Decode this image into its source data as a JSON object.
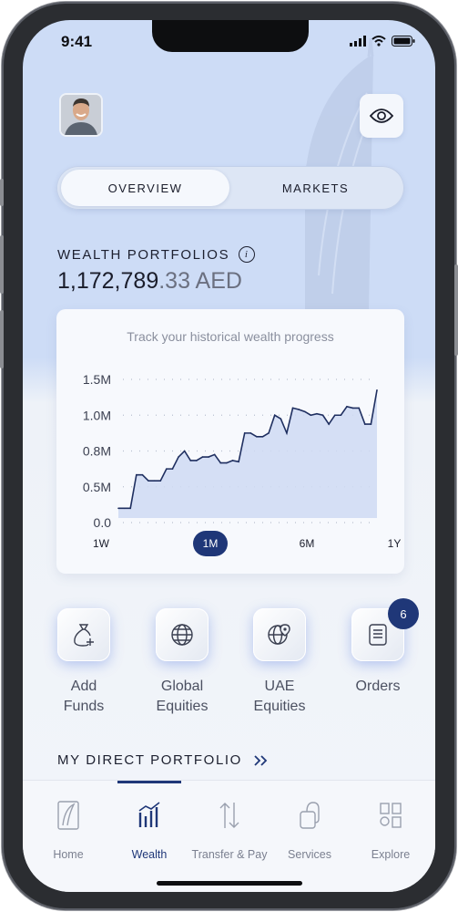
{
  "status_bar": {
    "time": "9:41"
  },
  "header": {
    "avatar_alt": "user-avatar",
    "eye_icon": "eye-icon"
  },
  "tabs": [
    {
      "label": "OVERVIEW",
      "active": true
    },
    {
      "label": "MARKETS",
      "active": false
    }
  ],
  "wealth": {
    "title": "WEALTH PORTFOLIOS",
    "amount_main": "1,172,789",
    "amount_decimal": ".33 AED"
  },
  "chart_data": {
    "type": "line",
    "title": "Track your historical wealth progress",
    "y_tick_labels": [
      "1.5M",
      "1.0M",
      "0.8M",
      "0.5M",
      "0.0"
    ],
    "y_ticks": [
      1.5,
      1.0,
      0.8,
      0.5,
      0.0
    ],
    "ylim": [
      0,
      1.5
    ],
    "series": [
      {
        "values": [
          0.2,
          0.2,
          0.2,
          0.6,
          0.6,
          0.55,
          0.55,
          0.55,
          0.65,
          0.65,
          0.75,
          0.8,
          0.72,
          0.72,
          0.75,
          0.75,
          0.77,
          0.7,
          0.7,
          0.72,
          0.71,
          0.9,
          0.9,
          0.88,
          0.88,
          0.9,
          1.0,
          0.98,
          0.9,
          1.1,
          1.08,
          1.05,
          1.0,
          1.02,
          1.0,
          0.95,
          1.0,
          1.0,
          1.12,
          1.1,
          1.1,
          0.95,
          0.95,
          1.35
        ]
      }
    ],
    "grid": false
  },
  "periods": [
    {
      "label": "1W",
      "active": false
    },
    {
      "label": "1M",
      "active": true
    },
    {
      "label": "6M",
      "active": false
    },
    {
      "label": "1Y",
      "active": false
    }
  ],
  "shortcuts": [
    {
      "label": "Add Funds",
      "icon": "money-bag-plus-icon"
    },
    {
      "label": "Global Equities",
      "icon": "globe-icon"
    },
    {
      "label": "UAE Equities",
      "icon": "globe-pin-icon"
    },
    {
      "label": "Orders",
      "icon": "document-icon"
    }
  ],
  "orders_badge": "6",
  "direct_portfolio": {
    "title": "MY DIRECT PORTFOLIO"
  },
  "nav": [
    {
      "label": "Home",
      "icon": "home-icon",
      "active": false
    },
    {
      "label": "Wealth",
      "icon": "wealth-chart-icon",
      "active": true
    },
    {
      "label": "Transfer & Pay",
      "icon": "transfer-arrows-icon",
      "active": false
    },
    {
      "label": "Services",
      "icon": "services-icon",
      "active": false
    },
    {
      "label": "Explore",
      "icon": "explore-grid-icon",
      "active": false
    }
  ],
  "colors": {
    "accent": "#1f3778",
    "background_top": "#cddcf6",
    "background_bottom": "#f2f5fa"
  }
}
